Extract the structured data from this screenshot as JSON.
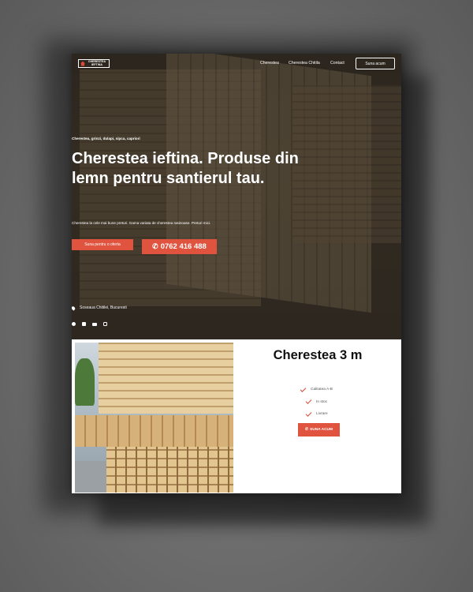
{
  "nav": {
    "logo_line1": "CHERESTEA",
    "logo_line2": "IEFTINA",
    "links": [
      "Cherestea",
      "Cherestea Chitila",
      "Contact"
    ],
    "cta_label": "Suna acum"
  },
  "hero": {
    "eyebrow": "Cherestea, grinzi, dulapi, sipca, capriori",
    "headline": "Cherestea ieftina. Produse din lemn pentru santierul tau.",
    "subtext": "Cherestea la cele mai bune preturi. Gama variata de cherestea rasinoase. Preturi mici.",
    "btn_offer": "Suna pentru o oferta",
    "btn_phone": "0762 416 488",
    "address": "Soseaua Chitilei, Bucuresti",
    "socials": [
      "facebook-icon",
      "twitter-icon",
      "youtube-icon",
      "instagram-icon"
    ]
  },
  "product": {
    "title": "Cherestea 3 m",
    "features": [
      "Calitatea A-B",
      "In stoc",
      "Livrare"
    ],
    "btn_call": "SUNA ACUM"
  },
  "colors": {
    "accent": "#e0533f",
    "hero_overlay": "#3b3328"
  }
}
